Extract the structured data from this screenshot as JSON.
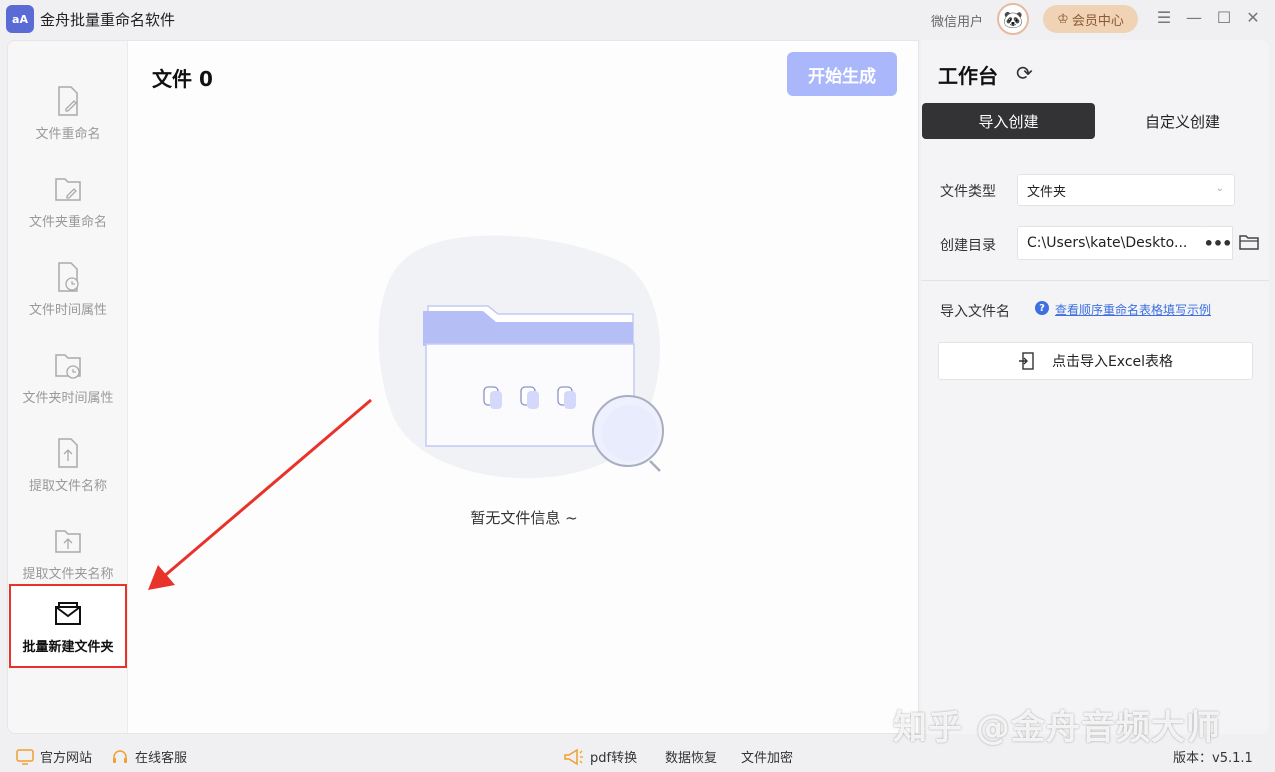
{
  "app": {
    "logo_text": "aA",
    "title": "金舟批量重命名软件",
    "user_name": "微信用户",
    "vip_label": "会员中心",
    "controls": {
      "menu": "☰",
      "minimize": "—",
      "maximize": "☐",
      "close": "✕"
    }
  },
  "sidebar": {
    "items": [
      {
        "label": "文件重命名",
        "icon": "file-edit-icon"
      },
      {
        "label": "文件夹重命名",
        "icon": "folder-edit-icon"
      },
      {
        "label": "文件时间属性",
        "icon": "file-clock-icon"
      },
      {
        "label": "文件夹时间属性",
        "icon": "folder-clock-icon"
      },
      {
        "label": "提取文件名称",
        "icon": "file-upload-icon"
      },
      {
        "label": "提取文件夹名称",
        "icon": "folder-upload-icon"
      },
      {
        "label": "批量新建文件夹",
        "icon": "mail-folder-icon",
        "active": true
      }
    ]
  },
  "main": {
    "files_title": "文件 0",
    "start_button": "开始生成",
    "empty_text": "暂无文件信息 ~"
  },
  "workbench": {
    "title": "工作台",
    "tabs": [
      "导入创建",
      "自定义创建"
    ],
    "file_type_label": "文件类型",
    "file_type_value": "文件夹",
    "dir_label": "创建目录",
    "dir_value": "C:\\Users\\kate\\Deskto...",
    "dots_label": "•••",
    "import_name_label": "导入文件名",
    "help_icon_text": "?",
    "help_link": "查看顺序重命名表格填写示例",
    "import_button": "点击导入Excel表格"
  },
  "bottom": {
    "website": "官方网站",
    "service": "在线客服",
    "pdf": "pdf转换",
    "recovery": "数据恢复",
    "encrypt": "文件加密",
    "version": "版本：v5.1.1"
  },
  "watermark": "知乎 @金舟音频大师",
  "colors": {
    "accent": "#aab8fb",
    "active_tab": "#333336",
    "highlight_border": "#e8332b",
    "link": "#3c6fe0",
    "vip": "#f0d2b4"
  }
}
